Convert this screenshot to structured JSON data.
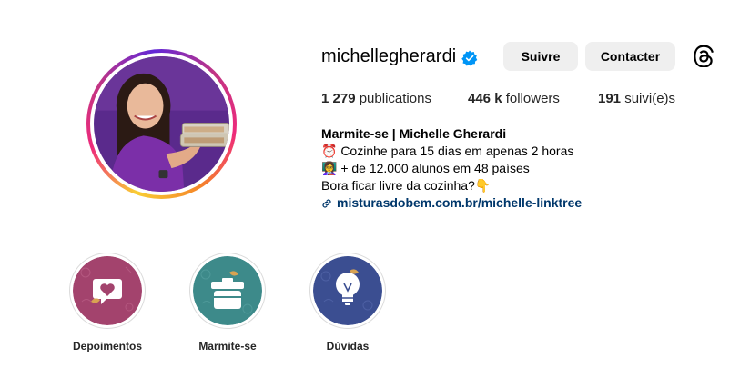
{
  "profile": {
    "username": "michellegherardi",
    "verified": true,
    "follow_label": "Suivre",
    "contact_label": "Contacter"
  },
  "stats": {
    "posts_count": "1 279",
    "posts_label": "publications",
    "followers_count": "446 k",
    "followers_label": "followers",
    "following_count": "191",
    "following_label": "suivi(e)s"
  },
  "bio": {
    "name": "Marmite-se | Michelle Gherardi",
    "line1": "⏰ Cozinhe para 15 dias em apenas 2 horas",
    "line2": "👩‍🏫 + de 12.000 alunos em 48 países",
    "line3": "Bora ficar livre da cozinha?👇",
    "link": "misturasdobem.com.br/michelle-linktree"
  },
  "highlights": [
    {
      "label": "Depoimentos",
      "icon": "heart-chat-icon",
      "color": "#a3436d"
    },
    {
      "label": "Marmite-se",
      "icon": "lunchbox-icon",
      "color": "#3d8a8a"
    },
    {
      "label": "Dúvidas",
      "icon": "lightbulb-icon",
      "color": "#3b4e91"
    }
  ],
  "colors": {
    "link": "#00376b",
    "button_bg": "#efefef",
    "verified": "#0095f6"
  }
}
